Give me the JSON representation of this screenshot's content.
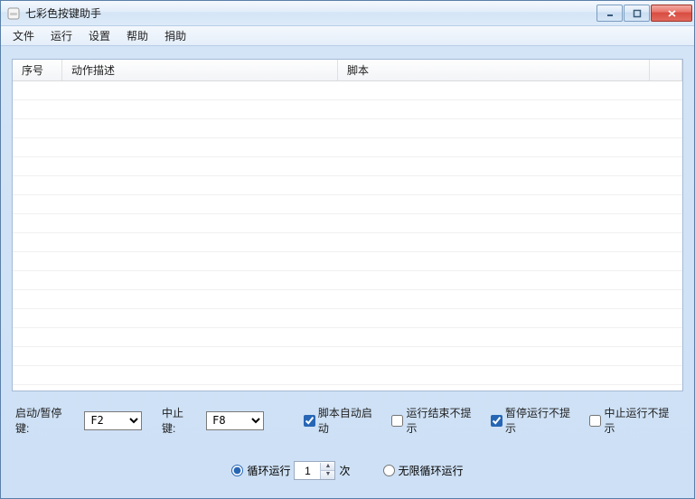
{
  "titlebar": {
    "title": "七彩色按键助手"
  },
  "menu": {
    "file": "文件",
    "run": "运行",
    "settings": "设置",
    "help": "帮助",
    "donate": "捐助"
  },
  "grid": {
    "headers": {
      "seq": "序号",
      "desc": "动作描述",
      "script": "脚本"
    },
    "rows": []
  },
  "controls": {
    "start_pause_label": "启动/暂停键:",
    "start_pause_value": "F2",
    "stop_label": "中止键:",
    "stop_value": "F8",
    "auto_start": {
      "label": "脚本自动启动",
      "checked": true
    },
    "no_end_prompt": {
      "label": "运行结束不提示",
      "checked": false
    },
    "no_pause_prompt": {
      "label": "暂停运行不提示",
      "checked": true
    },
    "no_stop_prompt": {
      "label": "中止运行不提示",
      "checked": false
    }
  },
  "loop": {
    "loop_label": "循环运行",
    "loop_count": "1",
    "loop_suffix": "次",
    "infinite_label": "无限循环运行",
    "selected": "loop"
  }
}
